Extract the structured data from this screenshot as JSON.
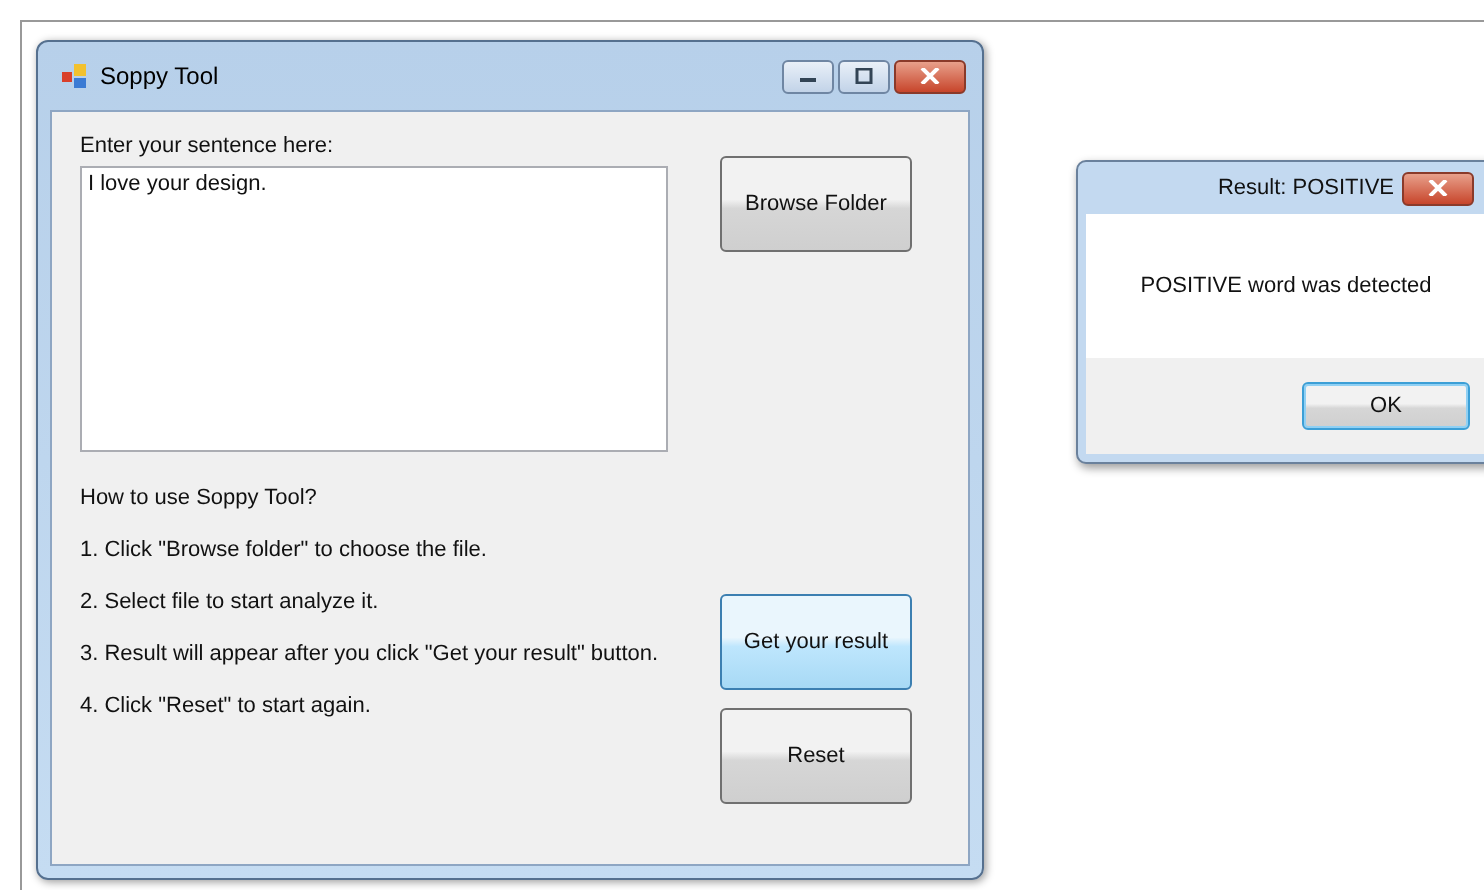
{
  "main_window": {
    "title": "Soppy Tool",
    "sentence_label": "Enter your sentence here:",
    "sentence_value": "I love your design.",
    "instructions_heading": "How to use Soppy Tool?",
    "instructions": [
      "1. Click \"Browse folder\" to choose the file.",
      "2. Select file to start analyze it.",
      "3. Result will appear after you click \"Get your result\" button.",
      "4. Click \"Reset\" to start again."
    ],
    "buttons": [
      {
        "label": "Browse Folder",
        "focused": false
      },
      {
        "label": "Get your result",
        "focused": true
      },
      {
        "label": "Reset",
        "focused": false
      }
    ]
  },
  "dialog": {
    "title": "Result: POSITIVE",
    "message": "POSITIVE word was detected",
    "button": {
      "label": "OK",
      "focused": true
    }
  }
}
